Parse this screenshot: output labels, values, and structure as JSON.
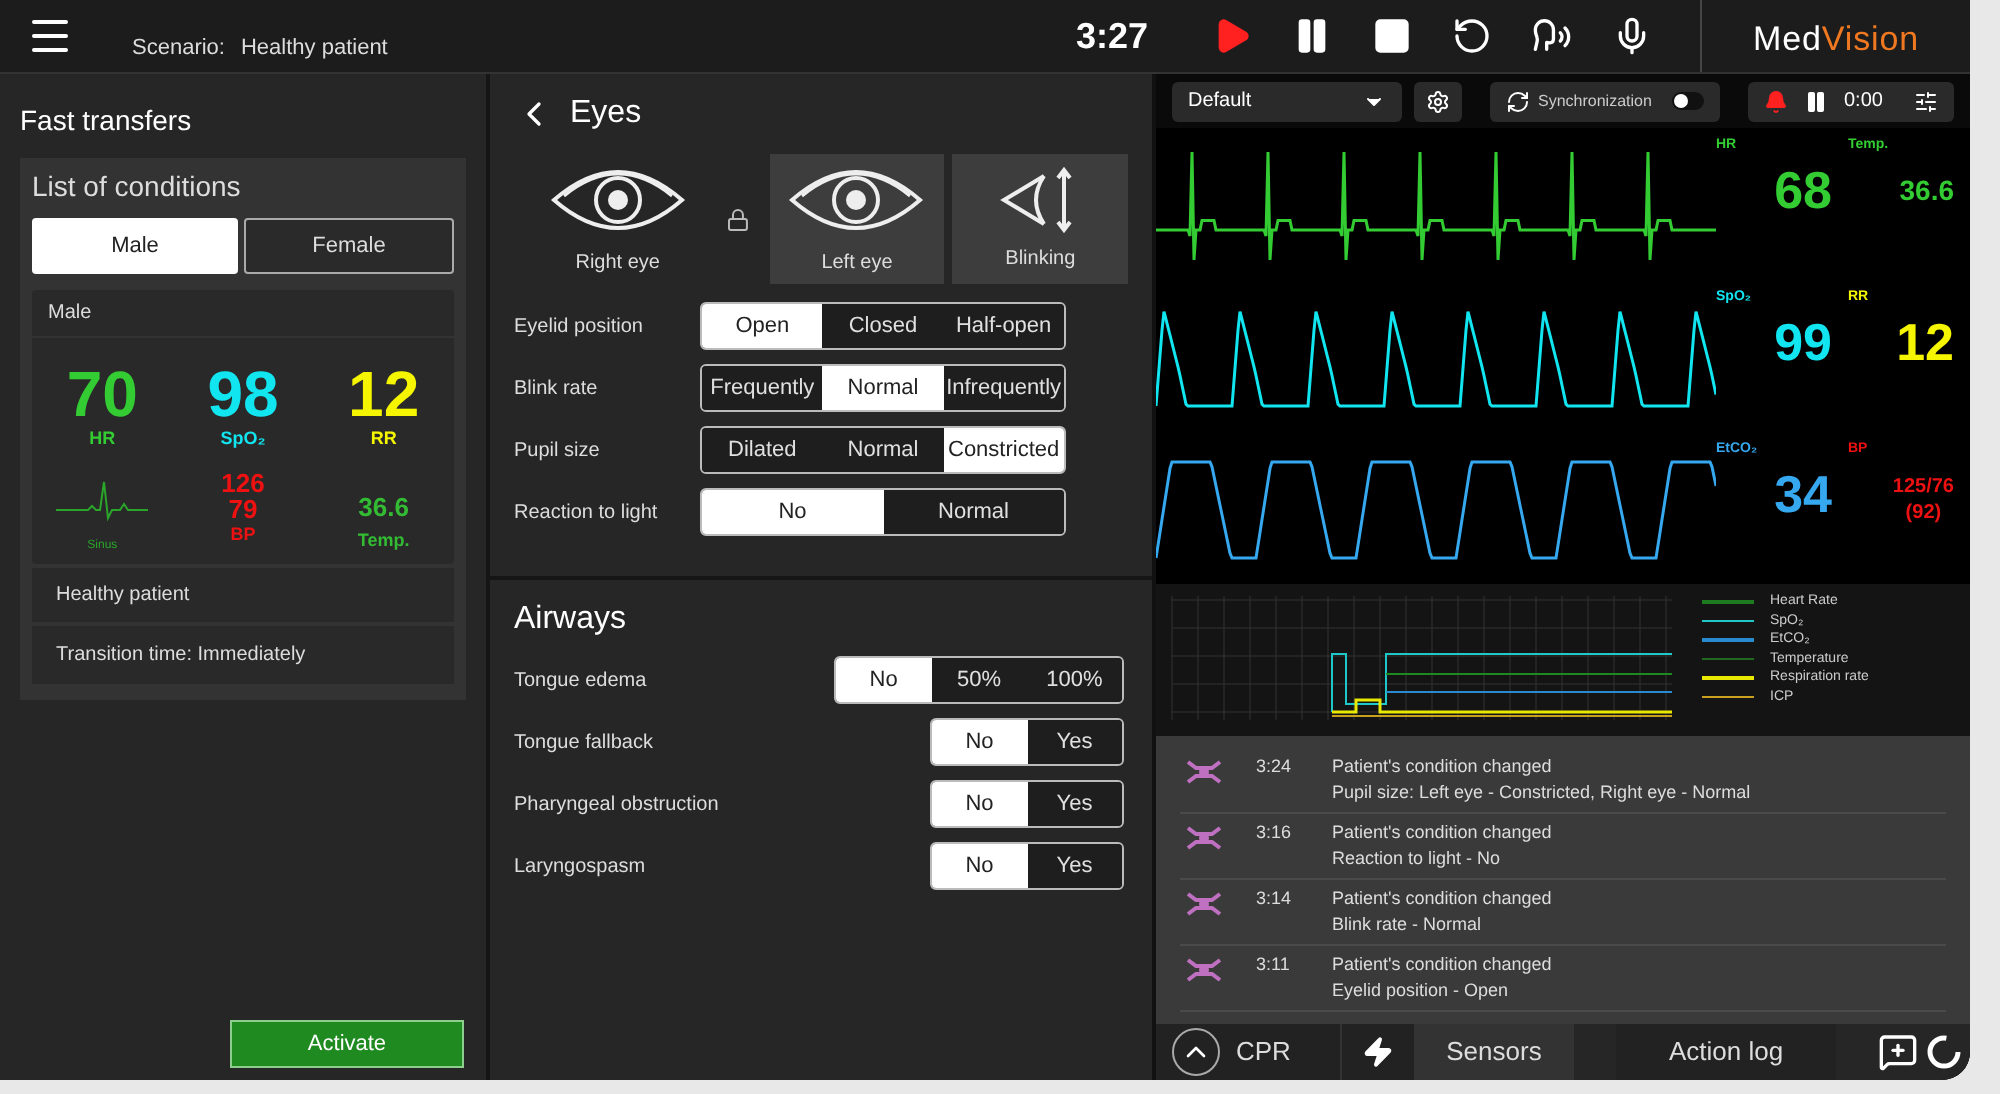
{
  "topbar": {
    "scenario_label": "Scenario:",
    "scenario": "Healthy patient",
    "time": "3:27",
    "controls": [
      {
        "kind": "play"
      },
      {
        "kind": "pause"
      },
      {
        "kind": "stop"
      },
      {
        "kind": "restart"
      },
      {
        "kind": "voice"
      },
      {
        "kind": "mic"
      }
    ],
    "logo": {
      "first": "Med",
      "second": "Vision"
    }
  },
  "left": {
    "title": "Fast transfers",
    "list_title": "List of conditions",
    "sex_tabs": [
      {
        "label": "Male",
        "selected": true
      },
      {
        "label": "Female",
        "selected": false
      }
    ],
    "card": {
      "header": "Male",
      "vitals": [
        {
          "value": "70",
          "label": "HR",
          "color": "#33cc33"
        },
        {
          "value": "98",
          "label": "SpO₂",
          "color": "#11e5f0"
        },
        {
          "value": "12",
          "label": "RR",
          "color": "#f5f500"
        }
      ],
      "rhythm": "Sinus",
      "bp": {
        "systolic": "126",
        "diastolic": "79",
        "label": "BP"
      },
      "temp": {
        "value": "36.6",
        "label": "Temp."
      }
    },
    "name": "Healthy patient",
    "transition": "Transition time: Immediately",
    "activate": "Activate"
  },
  "eyes": {
    "title": "Eyes",
    "views": [
      {
        "label": "Right eye",
        "kind": "eye",
        "selected": false
      },
      {
        "label": "Left eye",
        "kind": "eye",
        "selected": true
      },
      {
        "label": "Blinking",
        "kind": "blink",
        "selected": true
      }
    ],
    "rows": [
      {
        "label": "Eyelid position",
        "options": [
          {
            "label": "Open",
            "selected": true
          },
          {
            "label": "Closed",
            "selected": false
          },
          {
            "label": "Half-open",
            "selected": false
          }
        ]
      },
      {
        "label": "Blink rate",
        "options": [
          {
            "label": "Frequently",
            "selected": false
          },
          {
            "label": "Normal",
            "selected": true
          },
          {
            "label": "Infrequently",
            "selected": false
          }
        ]
      },
      {
        "label": "Pupil size",
        "options": [
          {
            "label": "Dilated",
            "selected": false
          },
          {
            "label": "Normal",
            "selected": false
          },
          {
            "label": "Constricted",
            "selected": true
          }
        ]
      },
      {
        "label": "Reaction to light",
        "options": [
          {
            "label": "No",
            "selected": true
          },
          {
            "label": "Normal",
            "selected": false
          }
        ]
      }
    ]
  },
  "airways": {
    "title": "Airways",
    "rows": [
      {
        "label": "Tongue edema",
        "options": [
          {
            "label": "No",
            "selected": true
          },
          {
            "label": "50%",
            "selected": false
          },
          {
            "label": "100%",
            "selected": false
          }
        ]
      },
      {
        "label": "Tongue fallback",
        "options": [
          {
            "label": "No",
            "selected": true
          },
          {
            "label": "Yes",
            "selected": false
          }
        ]
      },
      {
        "label": "Pharyngeal obstruction",
        "options": [
          {
            "label": "No",
            "selected": true
          },
          {
            "label": "Yes",
            "selected": false
          }
        ]
      },
      {
        "label": "Laryngospasm",
        "options": [
          {
            "label": "No",
            "selected": true
          },
          {
            "label": "Yes",
            "selected": false
          }
        ]
      }
    ]
  },
  "monitor": {
    "preset": "Default",
    "sync_label": "Synchronization",
    "sync_on": false,
    "timer": "0:00",
    "channels": [
      {
        "kind": "ecg",
        "label": "HR",
        "value": "68",
        "color": "#33cc33",
        "second": {
          "label": "Temp.",
          "value": "36.6",
          "color": "#33cc33"
        }
      },
      {
        "kind": "pleth",
        "label": "SpO₂",
        "value": "99",
        "color": "#11e5f0",
        "second": {
          "label": "RR",
          "value": "12",
          "color": "#f5f500"
        }
      },
      {
        "kind": "co2",
        "label": "EtCO₂",
        "value": "34",
        "color": "#35a8f0",
        "second": {
          "label": "BP",
          "value": "125/76",
          "value_2": "(92)",
          "color": "#ee1111"
        }
      }
    ]
  },
  "trend": {
    "legend": [
      {
        "name": "Heart Rate",
        "color": "#1e7a1e"
      },
      {
        "name": "SpO₂",
        "color": "#1ec8c8"
      },
      {
        "name": "EtCO₂",
        "color": "#2a8ad0"
      },
      {
        "name": "Temperature",
        "color": "#1f6a1f"
      },
      {
        "name": "Respiration rate",
        "color": "#e8e800"
      },
      {
        "name": "ICP",
        "color": "#c8a020"
      }
    ]
  },
  "log": [
    {
      "time": "3:24",
      "title": "Patient's condition changed",
      "detail": "Pupil size: Left eye - Constricted, Right eye - Normal"
    },
    {
      "time": "3:16",
      "title": "Patient's condition changed",
      "detail": "Reaction to light - No"
    },
    {
      "time": "3:14",
      "title": "Patient's condition changed",
      "detail": "Blink rate - Normal"
    },
    {
      "time": "3:11",
      "title": "Patient's condition changed",
      "detail": "Eyelid position - Open"
    }
  ],
  "bottom_tabs": [
    {
      "kind": "cpr",
      "label": "CPR",
      "selected": false
    },
    {
      "kind": "shock",
      "selected": false
    },
    {
      "kind": "text",
      "label": "Sensors",
      "selected": true
    },
    {
      "kind": "text",
      "label": "Action log",
      "selected": false
    }
  ]
}
